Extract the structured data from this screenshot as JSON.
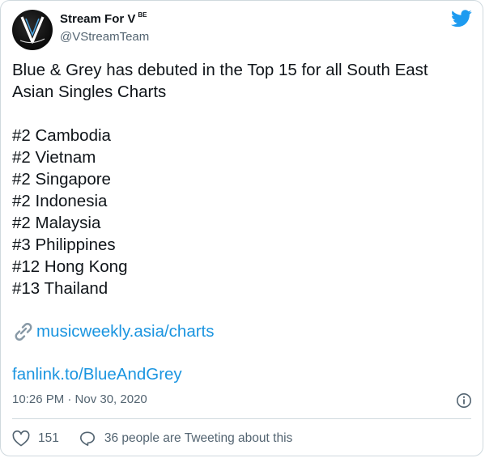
{
  "account": {
    "display_name": "Stream For V",
    "badge": "BE",
    "handle": "@VStreamTeam",
    "avatar_text": "V"
  },
  "tweet": {
    "text": "Blue & Grey has debuted in the Top 15 for all South East Asian Singles Charts\n\n#2 Cambodia\n#2 Vietnam\n#2 Singapore\n#2 Indonesia\n#2 Malaysia\n#3 Philippines\n#12 Hong Kong\n#13 Thailand",
    "link1": "musicweekly.asia/charts",
    "link2": "fanlink.to/BlueAndGrey",
    "timestamp": "10:26 PM · Nov 30, 2020"
  },
  "actions": {
    "likes": "151",
    "tweeting": "36 people are Tweeting about this"
  },
  "colors": {
    "link": "#1b95e0",
    "twitter_blue": "#1d9bf0",
    "muted": "#536471",
    "border": "#cfd9de"
  },
  "icons": [
    "twitter-bird-icon",
    "link-chain-icon",
    "info-icon",
    "heart-icon",
    "speech-bubble-icon"
  ]
}
